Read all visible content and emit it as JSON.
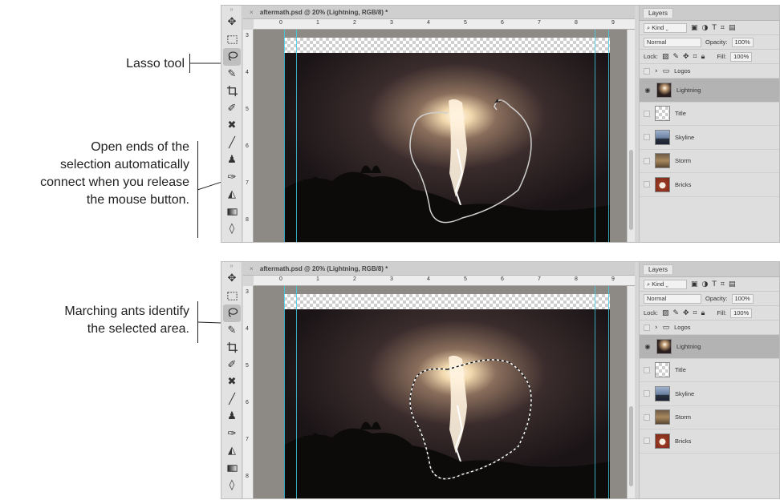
{
  "annotations": {
    "lasso": "Lasso tool",
    "open_ends": [
      "Open ends of the",
      "selection automatically",
      "connect when you release",
      "the mouse button."
    ],
    "marching": [
      "Marching ants identify",
      "the selected area."
    ]
  },
  "document": {
    "tab_close": "×",
    "tab_title_top": "aftermath.psd @ 20% (Lightning, RGB/8) *",
    "tab_title_bottom": "aftermath.psd @ 20% (Lightning, RGB/8) *",
    "ruler_top": [
      "0",
      "1",
      "2",
      "3",
      "4",
      "5",
      "6",
      "7",
      "8",
      "9"
    ],
    "ruler_left": [
      "3",
      "4",
      "5",
      "6",
      "7",
      "8"
    ]
  },
  "tools": [
    "move-icon",
    "marquee-icon",
    "lasso-icon",
    "quick-select-icon",
    "crop-icon",
    "eyedropper-icon",
    "healing-icon",
    "brush-icon",
    "stamp-icon",
    "history-brush-icon",
    "eraser-icon",
    "gradient-icon",
    "blur-icon",
    "dodge-icon"
  ],
  "layers_panel": {
    "tab": "Layers",
    "kind": "Kind",
    "blend_mode": "Normal",
    "opacity_label": "Opacity:",
    "opacity_value": "100%",
    "lock_label": "Lock:",
    "fill_label": "Fill:",
    "fill_value": "100%",
    "layers": [
      {
        "name": "Logos",
        "type": "group",
        "visible": false,
        "selected": false
      },
      {
        "name": "Lightning",
        "type": "image",
        "visible": true,
        "selected": true
      },
      {
        "name": "Title",
        "type": "transparent",
        "visible": false,
        "selected": false
      },
      {
        "name": "Skyline",
        "type": "image",
        "visible": false,
        "selected": false
      },
      {
        "name": "Storm",
        "type": "image",
        "visible": false,
        "selected": false
      },
      {
        "name": "Bricks",
        "type": "image",
        "visible": false,
        "selected": false
      }
    ]
  },
  "colors": {
    "guide": "#3fd0e6",
    "selected_layer": "#b3b3b3",
    "panel_bg": "#dedede"
  }
}
